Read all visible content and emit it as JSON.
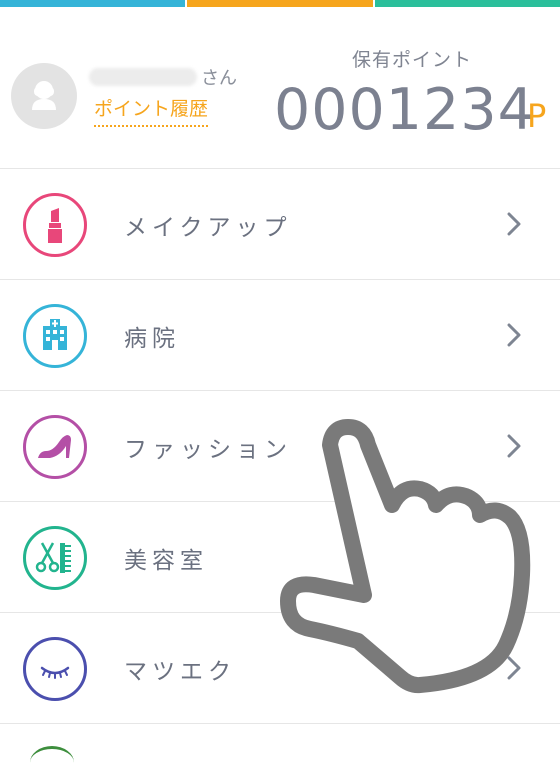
{
  "top_bar_colors": [
    "#35b4d8",
    "#f6a51d",
    "#2bbf9b"
  ],
  "header": {
    "user_suffix": "さん",
    "history_link": "ポイント履歴",
    "points_label": "保有ポイント",
    "points_value": "0001234",
    "points_unit": "P"
  },
  "menu": {
    "items": [
      {
        "label": "メイクアップ",
        "icon": "lipstick-icon",
        "color": "#e8477a"
      },
      {
        "label": "病院",
        "icon": "hospital-icon",
        "color": "#35b4d8"
      },
      {
        "label": "ファッション",
        "icon": "high-heel-icon",
        "color": "#b44fa6"
      },
      {
        "label": "美容室",
        "icon": "scissors-comb-icon",
        "color": "#22b48e"
      },
      {
        "label": "マツエク",
        "icon": "eyelash-icon",
        "color": "#4b4fae"
      }
    ]
  }
}
